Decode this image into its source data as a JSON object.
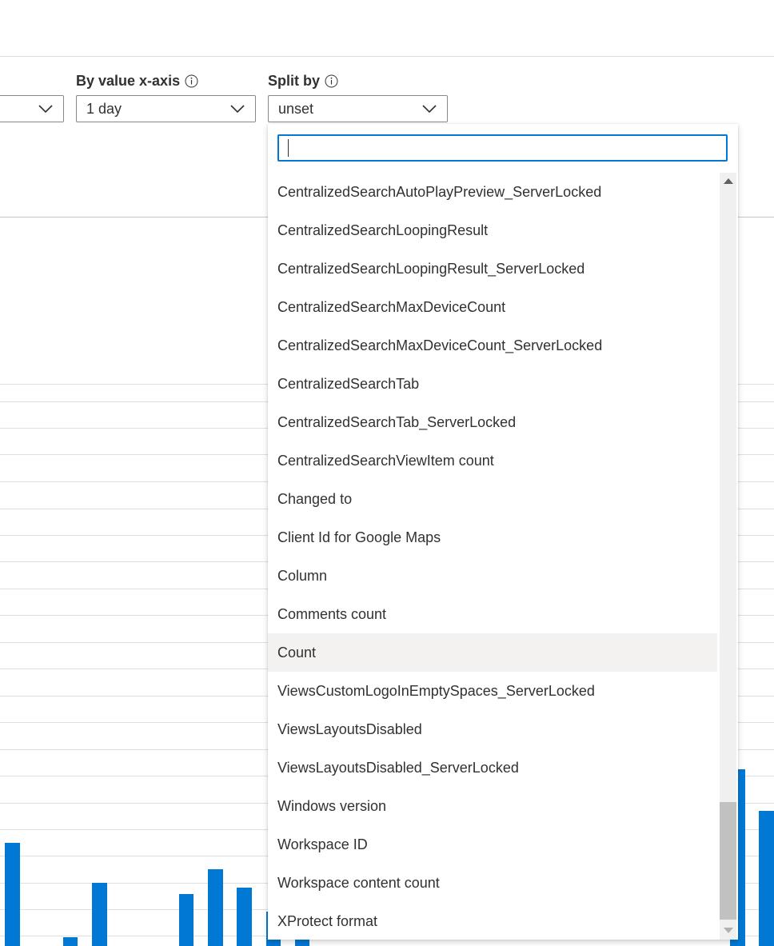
{
  "controls": {
    "by_value_label": "By value x-axis",
    "by_value_value": "1 day",
    "split_by_label": "Split by",
    "split_by_value": "unset"
  },
  "split_dropdown": {
    "search_value": "",
    "options": [
      "CentralizedSearchAutoPlayPreview_ServerLocked",
      "CentralizedSearchLoopingResult",
      "CentralizedSearchLoopingResult_ServerLocked",
      "CentralizedSearchMaxDeviceCount",
      "CentralizedSearchMaxDeviceCount_ServerLocked",
      "CentralizedSearchTab",
      "CentralizedSearchTab_ServerLocked",
      "CentralizedSearchViewItem count",
      "Changed to",
      "Client Id for Google Maps",
      "Column",
      "Comments count",
      "Count",
      "ViewsCustomLogoInEmptySpaces_ServerLocked",
      "ViewsLayoutsDisabled",
      "ViewsLayoutsDisabled_ServerLocked",
      "Windows version",
      "Workspace ID",
      "Workspace content count",
      "XProtect format"
    ],
    "hovered_option": "Count"
  },
  "colors": {
    "accent": "#0078d4",
    "bar": "#0078d4",
    "hover": "#f3f2f1"
  }
}
